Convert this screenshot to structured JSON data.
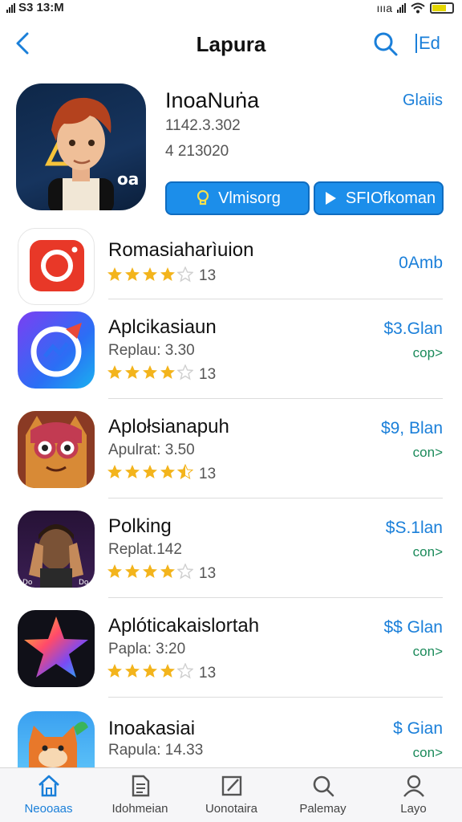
{
  "status_bar": {
    "time": "S3 13:M",
    "right_text": "ıııa"
  },
  "nav": {
    "title": "Lapura",
    "edit_label": "Ed"
  },
  "hero": {
    "name": "InoaNuṅa",
    "meta1": "1142.3.302",
    "meta2": "4 213020",
    "link": "Glaiis",
    "button_primary": "Vlmisorg",
    "button_secondary": "SFIOfkoman",
    "accent": "#1c8eea"
  },
  "apps": [
    {
      "title": "Romasiaharìuion",
      "sub": "",
      "count": "13",
      "price": "0Amb",
      "get": "",
      "rating": 4,
      "icon": "camera-app-icon"
    },
    {
      "title": "Aplcikasiaun",
      "sub": "Replau: 3.30",
      "count": "13",
      "price": "$3.Glan",
      "get": "cop>",
      "rating": 4,
      "icon": "messenger-app-icon"
    },
    {
      "title": "Aplołsianapuh",
      "sub": "Apulrat: 3.50",
      "count": "13",
      "price": "$9, Blan",
      "get": "con>",
      "rating": 4.5,
      "icon": "mascot-app-icon"
    },
    {
      "title": "Polking",
      "sub": "Replat.142",
      "count": "13",
      "price": "$S.1lan",
      "get": "con>",
      "rating": 4,
      "icon": "character-app-icon"
    },
    {
      "title": "Aplóticakaislortah",
      "sub": "Papla: 3:20",
      "count": "13",
      "price": "$$ Glan",
      "get": "con>",
      "rating": 4,
      "icon": "star-app-icon"
    },
    {
      "title": "Inoakasiai",
      "sub": "Rapula: 14.33",
      "count": "",
      "price": "$ Gian",
      "get": "con>",
      "rating": 0,
      "icon": "fox-app-icon"
    }
  ],
  "tabs": [
    {
      "label": "Neooaas",
      "icon": "home-icon",
      "active": true
    },
    {
      "label": "Idohmeian",
      "icon": "document-icon",
      "active": false
    },
    {
      "label": "Uonotaira",
      "icon": "edit-icon",
      "active": false
    },
    {
      "label": "Palemay",
      "icon": "search-icon",
      "active": false
    },
    {
      "label": "Layo",
      "icon": "person-icon",
      "active": false
    }
  ]
}
